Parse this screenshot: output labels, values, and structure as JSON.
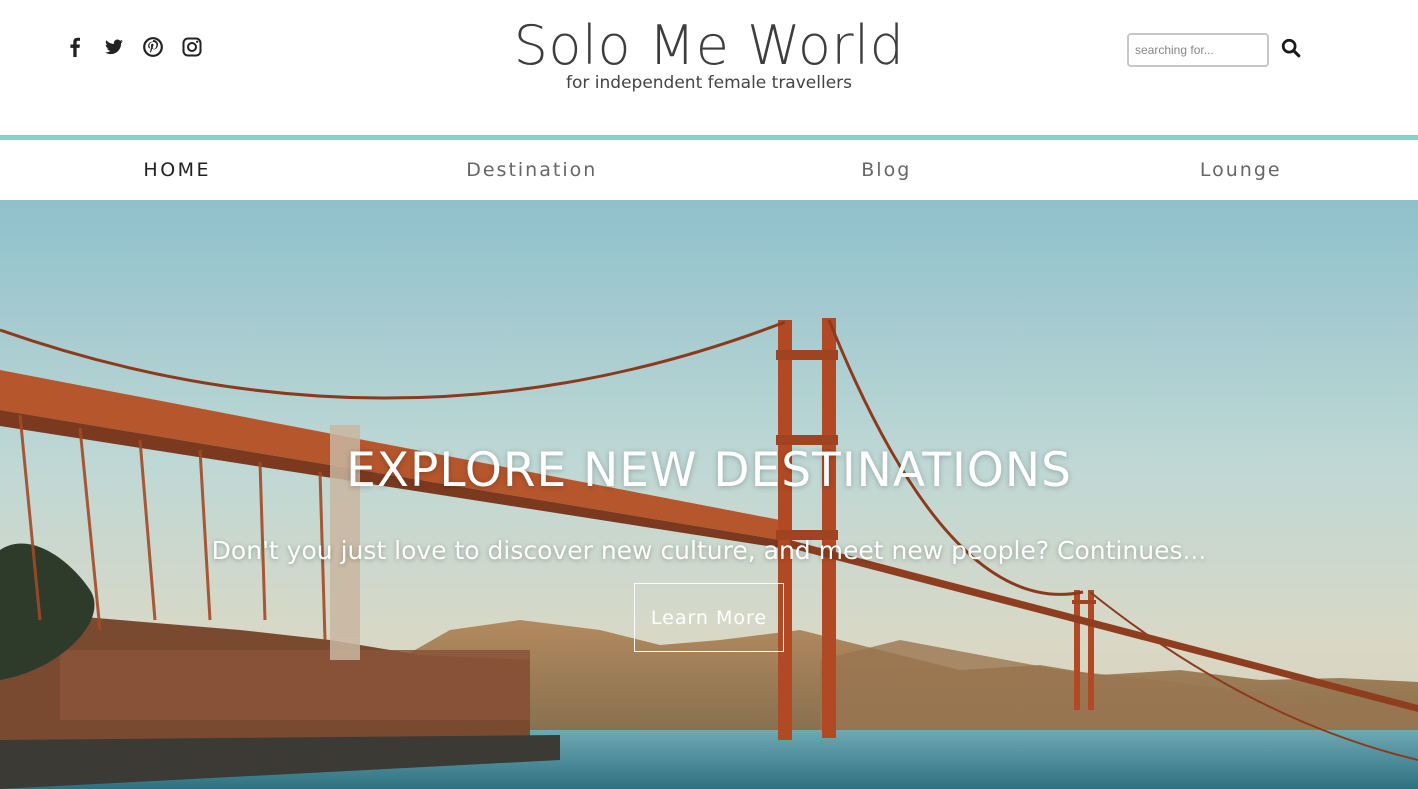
{
  "header": {
    "brand_title": "Solo Me World",
    "brand_subtitle": "for independent female travellers",
    "social_icons": [
      "facebook-icon",
      "twitter-icon",
      "pinterest-icon",
      "instagram-icon"
    ],
    "search": {
      "placeholder": "searching for...",
      "value": ""
    },
    "accent_color": "#7fd4cf"
  },
  "nav": {
    "items": [
      {
        "label": "HOME",
        "active": true
      },
      {
        "label": "Destination",
        "active": false
      },
      {
        "label": "Blog",
        "active": false
      },
      {
        "label": "Lounge",
        "active": false
      }
    ]
  },
  "hero": {
    "title": "EXPLORE NEW DESTINATIONS",
    "text": "Don't you just love to discover new culture, and meet new people? Continues...",
    "button_label": "Learn More"
  }
}
